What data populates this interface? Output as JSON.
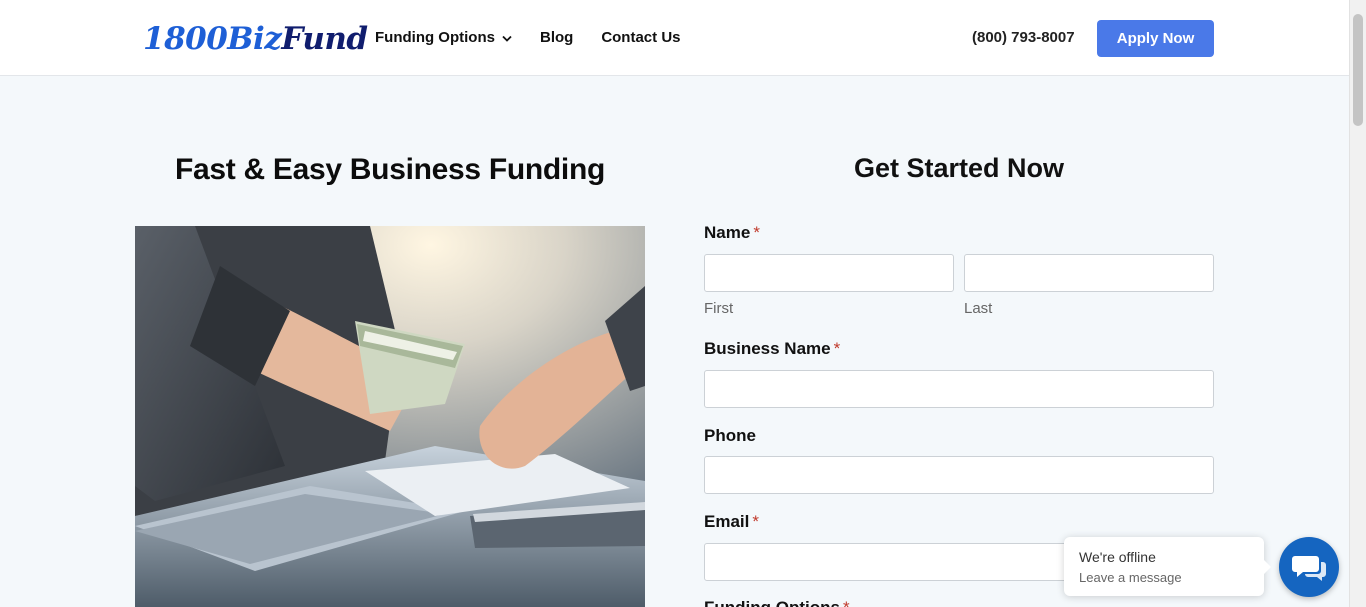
{
  "header": {
    "logo_part1": "1800Biz",
    "logo_part2": "Fund",
    "nav": [
      "Funding Options",
      "Blog",
      "Contact Us"
    ],
    "phone": "(800) 793-8007",
    "apply_label": "Apply Now"
  },
  "hero": {
    "title": "Fast & Easy Business Funding",
    "image": "business-funding-photo"
  },
  "form": {
    "title": "Get Started Now",
    "name_label": "Name",
    "required_mark": "*",
    "first_sub": "First",
    "last_sub": "Last",
    "business_label": "Business Name",
    "phone_label": "Phone",
    "email_label": "Email",
    "funding_label": "Funding Options"
  },
  "chat": {
    "title": "We're offline",
    "subtitle": "Leave a message",
    "icon": "chat-icon"
  },
  "colors": {
    "brand_blue": "#1e5fd6",
    "brand_navy": "#101d6e",
    "apply_button": "#4a79e8",
    "chat_button": "#1565c0",
    "required": "#c0392b",
    "page_bg": "#f4f8fb"
  }
}
